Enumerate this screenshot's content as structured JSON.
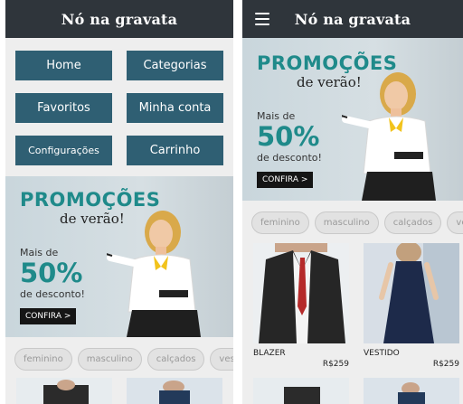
{
  "app": {
    "title": "Nó na gravata"
  },
  "menu": {
    "items": [
      "Home",
      "Categorias",
      "Favoritos",
      "Minha conta",
      "Configurações",
      "Carrinho"
    ]
  },
  "banner": {
    "title": "PROMOÇÕES",
    "subtitle": "de verão!",
    "mais_de": "Mais de",
    "percent": "50%",
    "desconto": "de desconto!",
    "cta": "CONFIRA >"
  },
  "chips": [
    "feminino",
    "masculino",
    "calçados",
    "ves"
  ],
  "products": [
    {
      "name": "BLAZER",
      "price": "R$259"
    },
    {
      "name": "VESTIDO",
      "price": "R$259"
    }
  ],
  "colors": {
    "appbar": "#2f353b",
    "button": "#2f5f73",
    "accent": "#1f8a8a"
  }
}
